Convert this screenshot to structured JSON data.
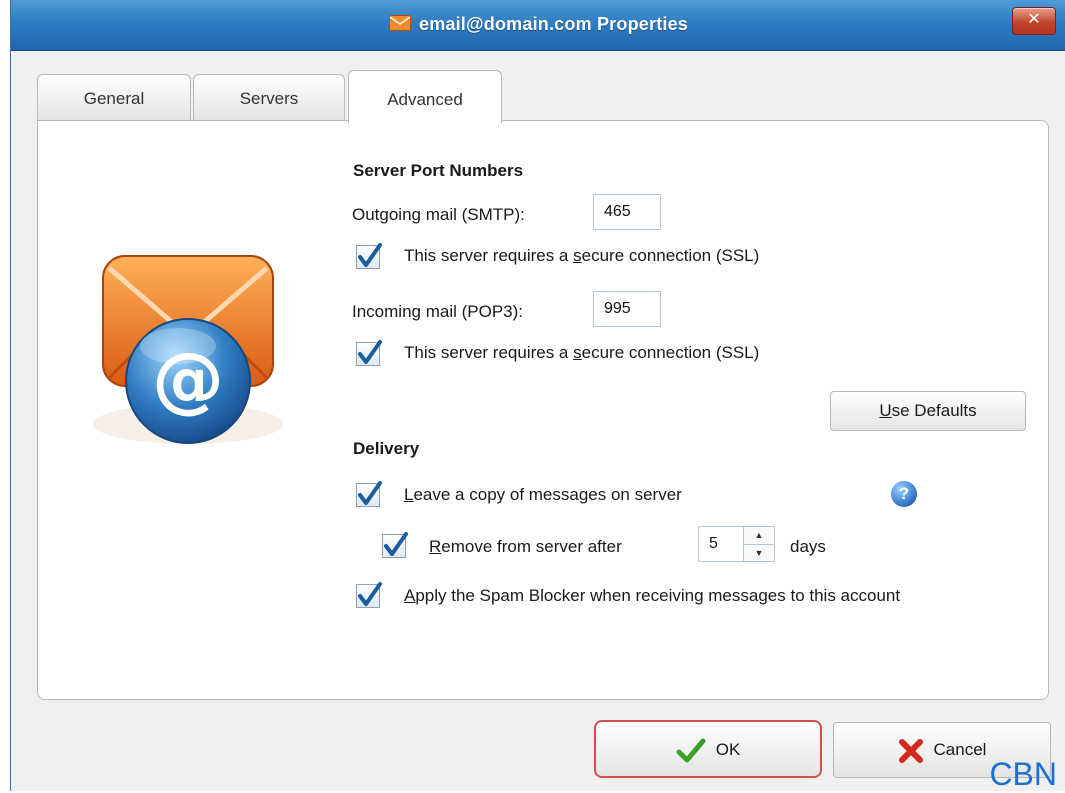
{
  "window": {
    "title": "email@domain.com Properties",
    "close_glyph": "✕"
  },
  "tabs": [
    {
      "label": "General"
    },
    {
      "label": "Servers"
    },
    {
      "label": "Advanced",
      "active": true
    }
  ],
  "server_ports": {
    "heading": "Server Port Numbers",
    "outgoing_label": "Outgoing mail (SMTP):",
    "outgoing_value": "465",
    "outgoing_ssl_pre": "This server requires a ",
    "outgoing_ssl_key": "s",
    "outgoing_ssl_post": "ecure connection (SSL)",
    "outgoing_ssl_checked": true,
    "incoming_label": "Incoming mail (POP3):",
    "incoming_value": "995",
    "incoming_ssl_pre": "This server requires a ",
    "incoming_ssl_key": "s",
    "incoming_ssl_post": "ecure connection (SSL)",
    "incoming_ssl_checked": true,
    "defaults_key": "U",
    "defaults_rest": "se Defaults"
  },
  "delivery": {
    "heading": "Delivery",
    "leave_copy_key": "L",
    "leave_copy_rest": "eave a copy of messages on server",
    "leave_copy_checked": true,
    "help_glyph": "?",
    "remove_key": "R",
    "remove_rest": "emove from server after",
    "remove_checked": true,
    "remove_days": "5",
    "days_label": "days",
    "spam_key": "A",
    "spam_rest": "pply the Spam Blocker when receiving messages to this account",
    "spam_checked": true
  },
  "footer": {
    "ok_label": "OK",
    "cancel_label": "Cancel"
  },
  "watermark": "CBN",
  "icons": {
    "title": "envelope-icon",
    "illustration": "email-at-envelope-icon",
    "ok": "checkmark-icon",
    "cancel": "red-x-icon"
  },
  "colors": {
    "titlebar": "#2f7cc2",
    "envelope": "#e8771f",
    "at_badge": "#2f7cc2",
    "ok_border": "#d05050",
    "watermark": "#1f6fd0"
  }
}
